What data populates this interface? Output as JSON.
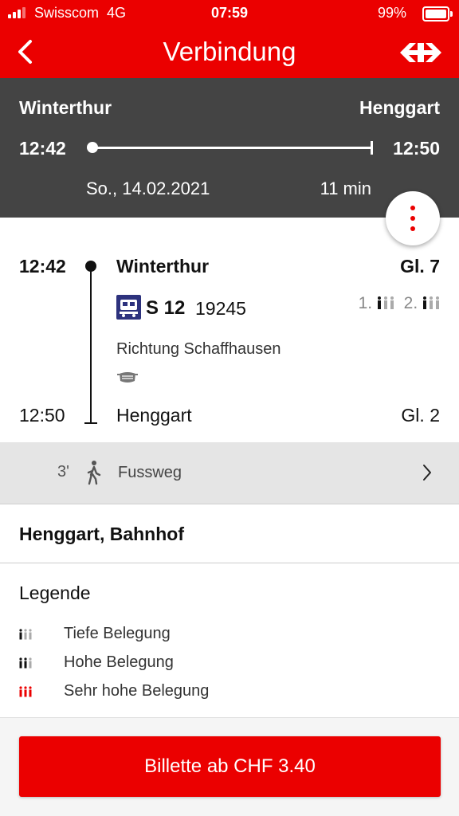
{
  "status_bar": {
    "carrier": "Swisscom",
    "network": "4G",
    "time": "07:59",
    "battery": "99%"
  },
  "header": {
    "title": "Verbindung",
    "back_icon": "chevron-left-icon",
    "logo_icon": "sbb-logo-icon",
    "color": "#eb0000"
  },
  "summary": {
    "from": "Winterthur",
    "to": "Henggart",
    "departure": "12:42",
    "arrival": "12:50",
    "date": "So., 14.02.2021",
    "duration": "11 min",
    "background": "#444444"
  },
  "leg": {
    "departure_time": "12:42",
    "departure_station": "Winterthur",
    "departure_platform": "Gl. 7",
    "train_icon": "train-icon",
    "train_name": "S 12",
    "train_number": "19245",
    "occupancy_first_label": "1.",
    "occupancy_second_label": "2.",
    "direction": "Richtung Schaffhausen",
    "mask_icon": "mask-icon",
    "arrival_time": "12:50",
    "arrival_station": "Henggart",
    "arrival_platform": "Gl. 2"
  },
  "walk": {
    "minutes": "3'",
    "label": "Fussweg"
  },
  "destination": {
    "name": "Henggart, Bahnhof"
  },
  "legend": {
    "title": "Legende",
    "items": [
      {
        "label": "Tiefe Belegung",
        "level": 1
      },
      {
        "label": "Hohe Belegung",
        "level": 2
      },
      {
        "label": "Sehr hohe Belegung",
        "level": 3
      }
    ]
  },
  "footer": {
    "button_label": "Billette ab CHF 3.40"
  }
}
